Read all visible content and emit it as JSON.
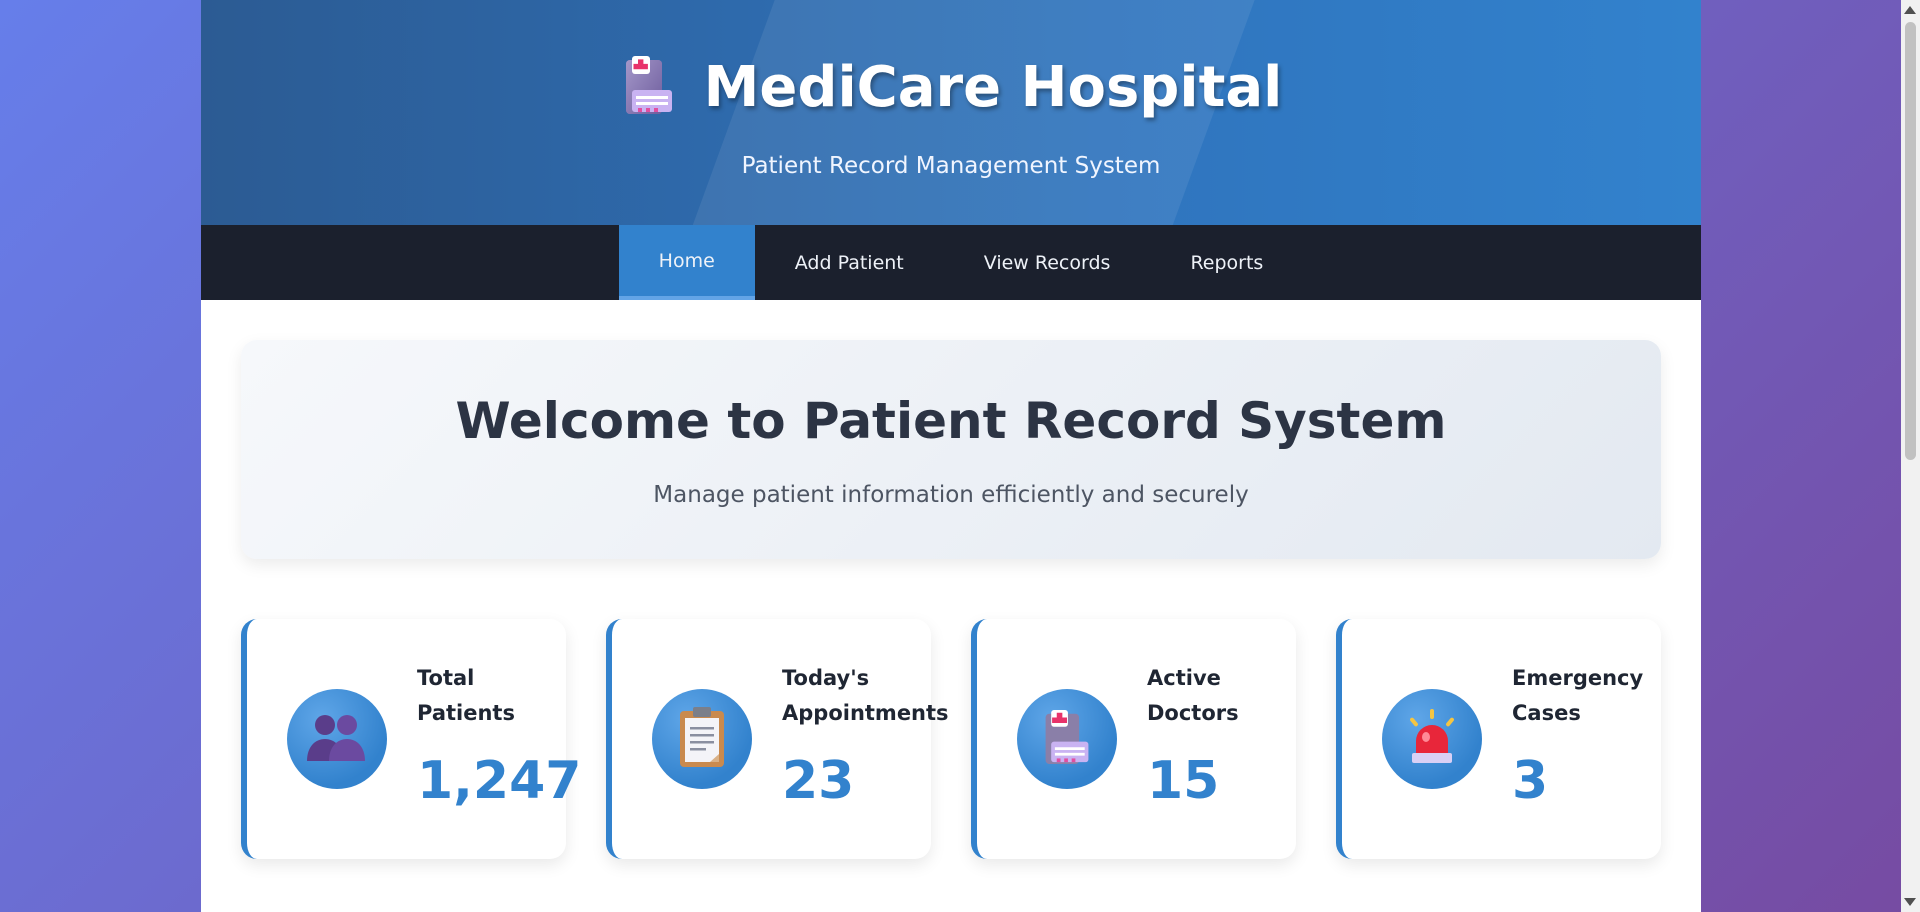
{
  "header": {
    "title": "MediCare Hospital",
    "subtitle": "Patient Record Management System",
    "logo_icon": "hospital-icon"
  },
  "nav": {
    "items": [
      {
        "label": "Home",
        "active": true
      },
      {
        "label": "Add Patient",
        "active": false
      },
      {
        "label": "View Records",
        "active": false
      },
      {
        "label": "Reports",
        "active": false
      }
    ]
  },
  "welcome": {
    "title": "Welcome to Patient Record System",
    "subtitle": "Manage patient information efficiently and securely"
  },
  "stats": [
    {
      "label_line1": "Total",
      "label_line2": "Patients",
      "value": "1,247",
      "icon": "patients-icon"
    },
    {
      "label_line1": "Today's",
      "label_line2": "Appointments",
      "value": "23",
      "icon": "clipboard-icon"
    },
    {
      "label_line1": "Active",
      "label_line2": "Doctors",
      "value": "15",
      "icon": "hospital-icon"
    },
    {
      "label_line1": "Emergency",
      "label_line2": "Cases",
      "value": "3",
      "icon": "siren-icon"
    }
  ],
  "colors": {
    "accent": "#3282cd",
    "nav_bg": "#1b202d",
    "page_bg_start": "#667eea",
    "page_bg_end": "#764ba2"
  }
}
